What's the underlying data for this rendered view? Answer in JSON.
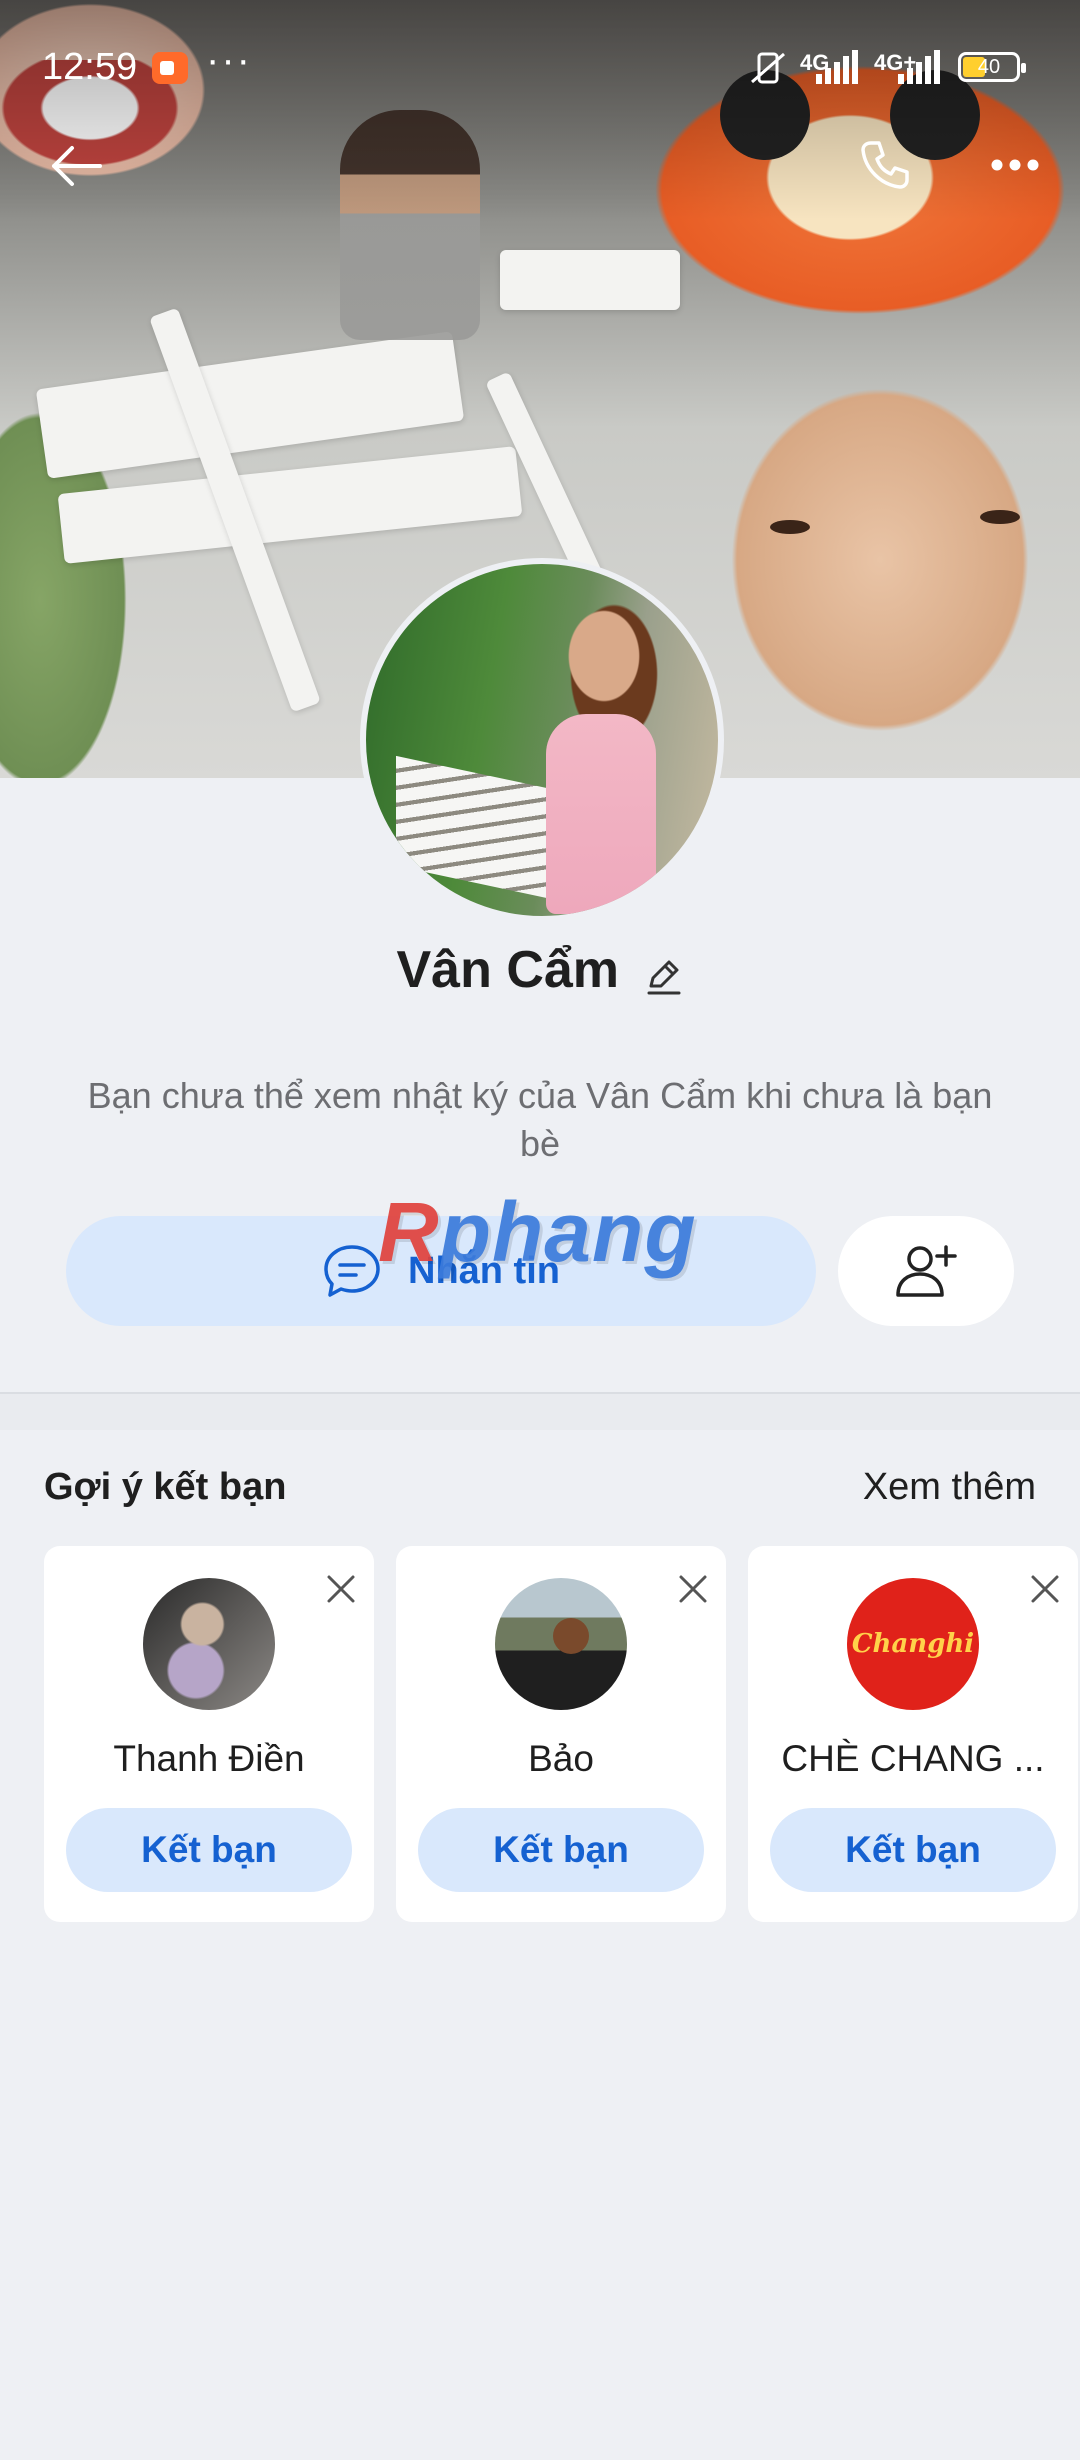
{
  "status_bar": {
    "time": "12:59",
    "more": "···",
    "network1": "4G",
    "network2": "4G+",
    "battery": "40"
  },
  "profile": {
    "name": "Vân Cẩm",
    "notice": "Bạn chưa thể xem nhật ký của Vân Cẩm khi chưa là bạn bè"
  },
  "actions": {
    "message_label": "Nhắn tin"
  },
  "watermark": {
    "first": "R",
    "rest": "phang"
  },
  "suggestions": {
    "title": "Gợi ý kết bạn",
    "see_more": "Xem thêm",
    "items": [
      {
        "name": "Thanh Điền",
        "button": "Kết bạn"
      },
      {
        "name": "Bảo",
        "button": "Kết bạn"
      },
      {
        "name": "CHÈ CHANG ...",
        "button": "Kết bạn"
      }
    ],
    "logo_text": "Changhi"
  },
  "colors": {
    "accent": "#1561d1",
    "button_bg": "#d9e8fc",
    "page_bg": "#eef0f4"
  }
}
